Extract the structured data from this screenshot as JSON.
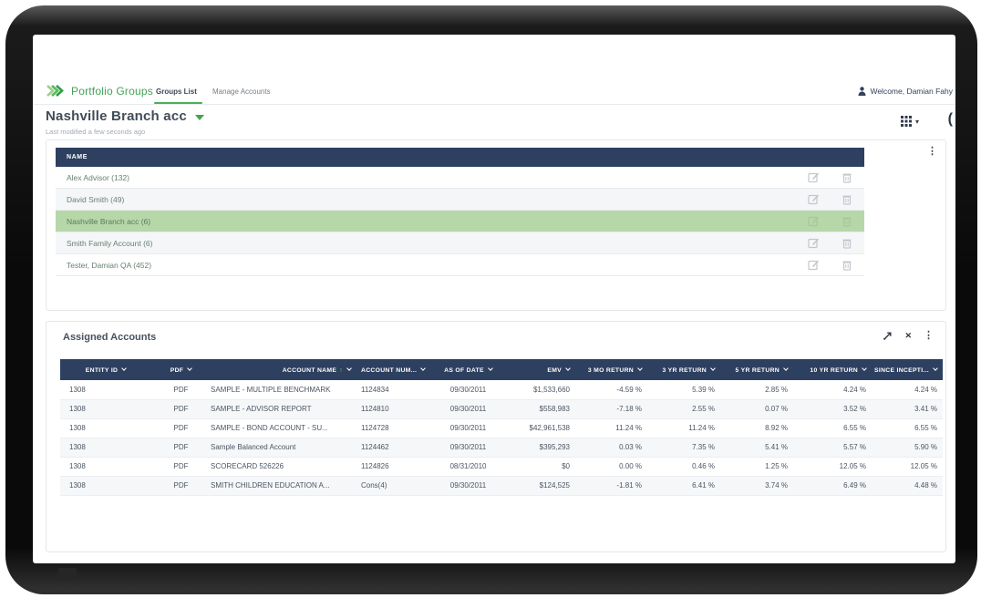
{
  "header": {
    "app_title": "Portfolio Groups",
    "tabs": [
      {
        "label": "Groups List",
        "active": true
      },
      {
        "label": "Manage Accounts",
        "active": false
      }
    ],
    "welcome": "Welcome, Damian Fahy"
  },
  "page": {
    "group_name": "Nashville Branch acc",
    "last_modified": "Last modified a few seconds ago"
  },
  "groups_table": {
    "header": "NAME",
    "rows": [
      {
        "name": "Alex Advisor (132)",
        "selected": false
      },
      {
        "name": "David Smith (49)",
        "selected": false
      },
      {
        "name": "Nashville Branch acc (6)",
        "selected": true
      },
      {
        "name": "Smith Family Account (6)",
        "selected": false
      },
      {
        "name": "Tester, Damian QA (452)",
        "selected": false
      }
    ]
  },
  "assigned_accounts": {
    "title": "Assigned Accounts",
    "columns": [
      {
        "label": "ENTITY ID"
      },
      {
        "label": "PDF"
      },
      {
        "label": "ACCOUNT NAME",
        "sorted": "asc"
      },
      {
        "label": "ACCOUNT NUM..."
      },
      {
        "label": "AS OF DATE"
      },
      {
        "label": "EMV"
      },
      {
        "label": "3 MO RETURN"
      },
      {
        "label": "3 YR RETURN"
      },
      {
        "label": "5 YR RETURN"
      },
      {
        "label": "10 YR RETURN"
      },
      {
        "label": "SINCE INCEPTI..."
      }
    ],
    "rows": [
      [
        "1308",
        "PDF",
        "SAMPLE - MULTIPLE BENCHMARK",
        "1124834",
        "09/30/2011",
        "$1,533,660",
        "-4.59 %",
        "5.39 %",
        "2.85 %",
        "4.24 %",
        "4.24 %"
      ],
      [
        "1308",
        "PDF",
        "SAMPLE - ADVISOR REPORT",
        "1124810",
        "09/30/2011",
        "$558,983",
        "-7.18 %",
        "2.55 %",
        "0.07 %",
        "3.52 %",
        "3.41 %"
      ],
      [
        "1308",
        "PDF",
        "SAMPLE - BOND ACCOUNT - SU...",
        "1124728",
        "09/30/2011",
        "$42,961,538",
        "11.24 %",
        "11.24 %",
        "8.92 %",
        "6.55 %",
        "6.55 %"
      ],
      [
        "1308",
        "PDF",
        "Sample Balanced Account",
        "1124462",
        "09/30/2011",
        "$395,293",
        "0.03 %",
        "7.35 %",
        "5.41 %",
        "5.57 %",
        "5.90 %"
      ],
      [
        "1308",
        "PDF",
        "SCORECARD 526226",
        "1124826",
        "08/31/2010",
        "$0",
        "0.00 %",
        "0.46 %",
        "1.25 %",
        "12.05 %",
        "12.05 %"
      ],
      [
        "1308",
        "PDF",
        "SMITH CHILDREN EDUCATION A...",
        "Cons(4)",
        "09/30/2011",
        "$124,525",
        "-1.81 %",
        "6.41 %",
        "3.74 %",
        "6.49 %",
        "4.48 %"
      ]
    ]
  },
  "icons": {
    "kebab": "⋮",
    "close": "✕",
    "sort_asc": "↑",
    "grid_caret": "▾",
    "clipped": "("
  },
  "colors": {
    "brand_green": "#43a24e",
    "table_header_navy": "#2e4060",
    "selected_row_green": "#b6d7a8",
    "link_green": "#53995d"
  }
}
